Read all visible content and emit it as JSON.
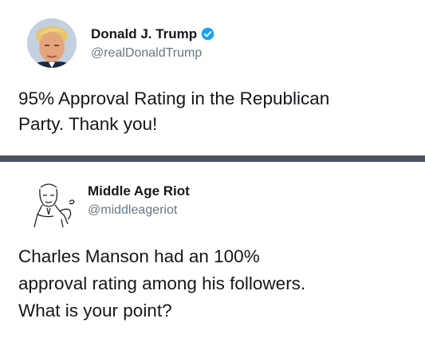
{
  "tweets": [
    {
      "name": "Donald J. Trump",
      "handle": "@realDonaldTrump",
      "verified": true,
      "avatar_icon": "profile-photo-icon",
      "text": "95% Approval Rating in the Republican\nParty. Thank you!"
    },
    {
      "name": "Middle Age Riot",
      "handle": "@middleageriot",
      "verified": false,
      "avatar_icon": "vintage-man-illustration-icon",
      "text": "Charles Manson had an 100%\napproval rating among his followers.\nWhat is your point?"
    }
  ],
  "colors": {
    "verified_badge": "#1da1f2",
    "handle": "#657786",
    "divider": "#4a5560"
  }
}
